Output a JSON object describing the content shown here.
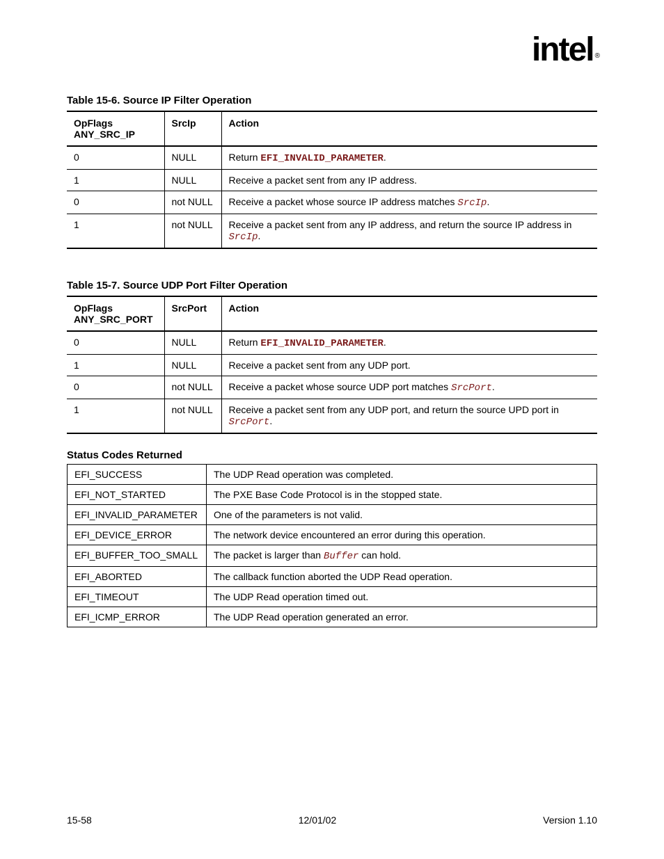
{
  "logo": "intel",
  "logo_sub": "®",
  "table1": {
    "caption": "Table 15-6. Source IP Filter Operation",
    "headers": [
      "OpFlags\nANY_SRC_IP",
      "SrcIp",
      "Action"
    ],
    "rows": [
      {
        "a": "0",
        "b": "NULL",
        "c_pre": "Return ",
        "c_kw": "EFI_INVALID_PARAMETER",
        "c_post": "."
      },
      {
        "a": "1",
        "b": "NULL",
        "c": "Receive a packet sent from any IP address."
      },
      {
        "a": "0",
        "b": "not NULL",
        "c_pre": "Receive a packet whose source IP address matches ",
        "c_it": "SrcIp",
        "c_post": "."
      },
      {
        "a": "1",
        "b": "not NULL",
        "c_pre": "Receive a packet sent from any IP address, and return the source IP address in ",
        "c_it": "SrcIp",
        "c_post": "."
      }
    ]
  },
  "table2": {
    "caption": "Table 15-7. Source UDP Port Filter Operation",
    "headers": [
      "OpFlags\nANY_SRC_PORT",
      "SrcPort",
      "Action"
    ],
    "rows": [
      {
        "a": "0",
        "b": "NULL",
        "c_pre": "Return ",
        "c_kw": "EFI_INVALID_PARAMETER",
        "c_post": "."
      },
      {
        "a": "1",
        "b": "NULL",
        "c": "Receive a packet sent from any UDP port."
      },
      {
        "a": "0",
        "b": "not NULL",
        "c_pre": "Receive a packet whose source UDP port matches ",
        "c_it": "SrcPort",
        "c_post": "."
      },
      {
        "a": "1",
        "b": "not NULL",
        "c_pre": "Receive a packet sent from any UDP port, and return the source UPD port in ",
        "c_it": "SrcPort",
        "c_post": "."
      }
    ]
  },
  "status": {
    "heading": "Status Codes Returned",
    "rows": [
      {
        "code": "EFI_SUCCESS",
        "desc": "The UDP Read operation was completed."
      },
      {
        "code": "EFI_NOT_STARTED",
        "desc": "The PXE Base Code Protocol is in the stopped state."
      },
      {
        "code": "EFI_INVALID_PARAMETER",
        "desc": "One of the parameters is not valid."
      },
      {
        "code": "EFI_DEVICE_ERROR",
        "desc": "The network device encountered an error during this operation."
      },
      {
        "code": "EFI_BUFFER_TOO_SMALL",
        "desc_pre": "The packet is larger than ",
        "desc_it": "Buffer",
        "desc_post": " can hold."
      },
      {
        "code": "EFI_ABORTED",
        "desc": "The callback function aborted the UDP Read operation."
      },
      {
        "code": "EFI_TIMEOUT",
        "desc": "The UDP Read operation timed out."
      },
      {
        "code": "EFI_ICMP_ERROR",
        "desc": "The UDP Read operation generated an error."
      }
    ]
  },
  "footer": {
    "left": "15-58",
    "center": "12/01/02",
    "right": "Version 1.10"
  }
}
